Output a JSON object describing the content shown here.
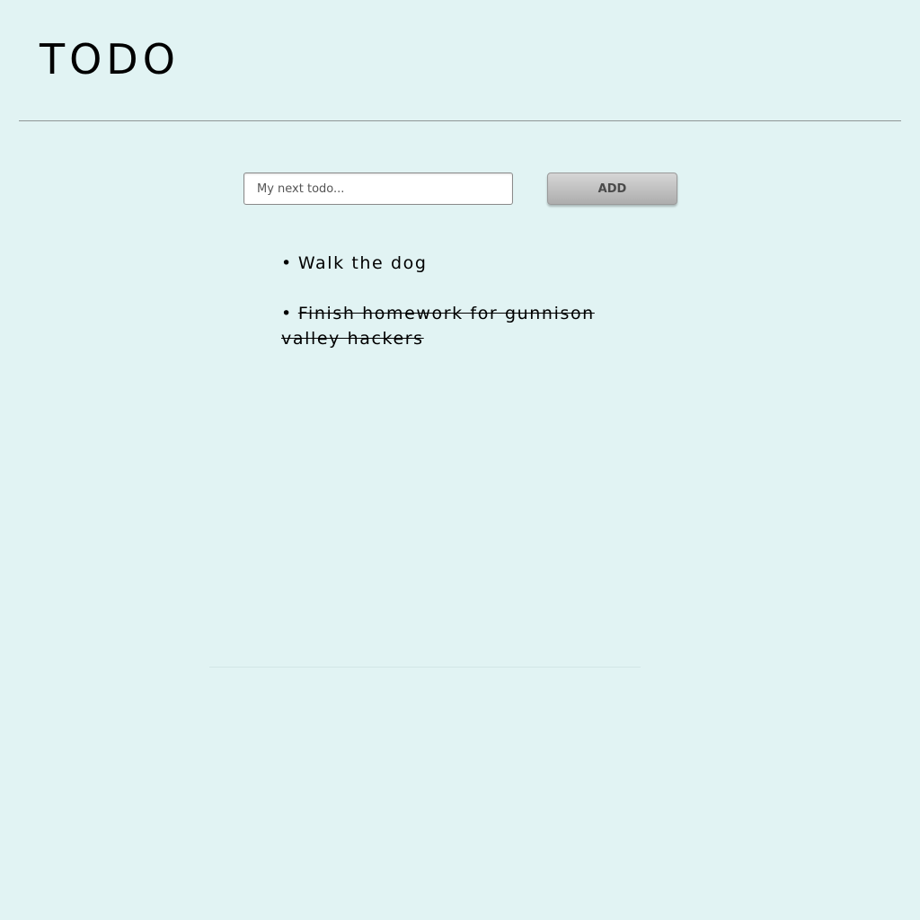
{
  "app": {
    "title": "TODO"
  },
  "form": {
    "input_placeholder": "My next todo...",
    "input_value": "",
    "add_label": "ADD"
  },
  "todos": [
    {
      "text": "Walk the dog",
      "done": false
    },
    {
      "text": "Finish homework for gunnison valley hackers",
      "done": true
    }
  ],
  "colors": {
    "background": "#e1f3f3",
    "divider": "#8e9696",
    "button_gradient_top": "#d6d6d6",
    "button_gradient_bottom": "#adadad",
    "button_text": "#4a4a4a"
  }
}
